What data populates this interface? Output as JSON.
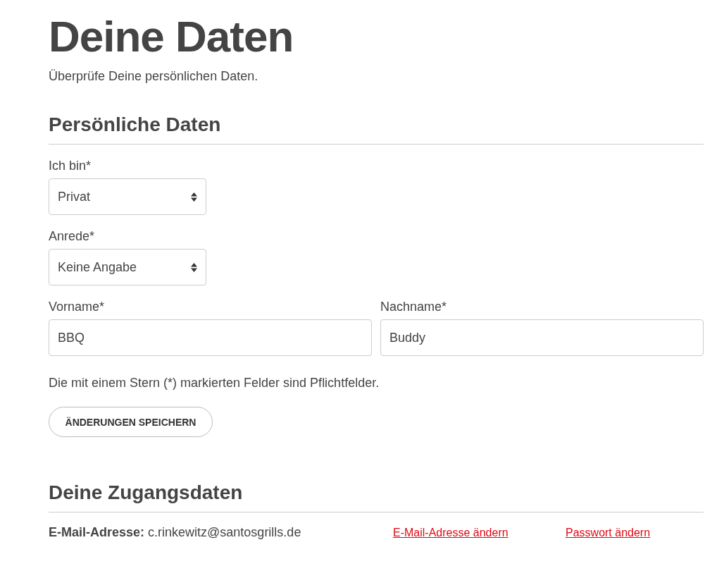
{
  "page": {
    "title": "Deine Daten",
    "subtitle": "Überprüfe Deine persönlichen Daten."
  },
  "personal": {
    "heading": "Persönliche Daten",
    "rows": [
      {
        "fields": [
          {
            "kind": "select",
            "label": "Ich bin*",
            "value": "Privat"
          }
        ]
      },
      {
        "fields": [
          {
            "kind": "select",
            "label": "Anrede*",
            "value": "Keine Angabe"
          }
        ]
      },
      {
        "fields": [
          {
            "kind": "text",
            "label": "Vorname*",
            "value": "BBQ"
          },
          {
            "kind": "text",
            "label": "Nachname*",
            "value": "Buddy"
          }
        ]
      }
    ],
    "note": "Die mit einem Stern (*) markierten Felder sind Pflichtfelder.",
    "save_button": "ÄNDERUNGEN SPEICHERN"
  },
  "access": {
    "heading": "Deine Zugangsdaten",
    "email": "**E-Mail-Adresse:** c.rinkewitz@santosgrills.de",
    "links": [
      "E-Mail-Adresse ändern",
      "Passwort ändern"
    ]
  }
}
